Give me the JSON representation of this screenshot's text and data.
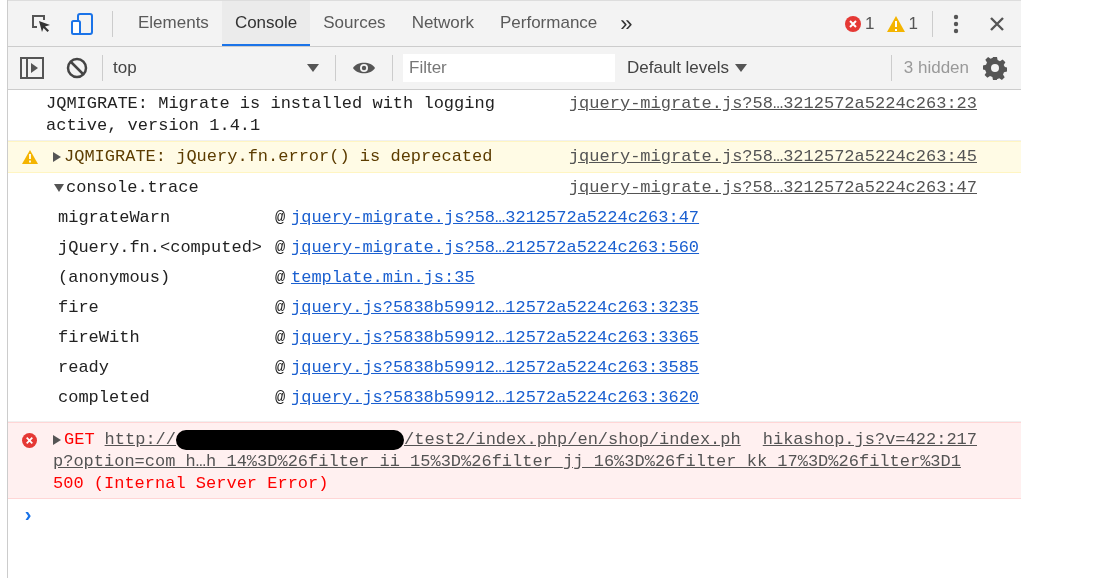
{
  "tabs": [
    {
      "label": "Elements",
      "selected": false
    },
    {
      "label": "Console",
      "selected": true
    },
    {
      "label": "Sources",
      "selected": false
    },
    {
      "label": "Network",
      "selected": false
    },
    {
      "label": "Performance",
      "selected": false
    }
  ],
  "more_tabs": "»",
  "counts": {
    "errors": "1",
    "warnings": "1"
  },
  "toolbar": {
    "context": "top",
    "filter_placeholder": "Filter",
    "levels": "Default levels",
    "hidden": "3 hidden"
  },
  "messages": [
    {
      "kind": "log",
      "text": "JQMIGRATE: Migrate is installed with logging active, version 1.4.1",
      "source": "jquery-migrate.js?58…3212572a5224c263:23"
    },
    {
      "kind": "warning",
      "expanded": false,
      "text": "JQMIGRATE: jQuery.fn.error() is deprecated",
      "source": "jquery-migrate.js?58…3212572a5224c263:45"
    },
    {
      "kind": "trace",
      "expanded": true,
      "text": "console.trace",
      "source": "jquery-migrate.js?58…3212572a5224c263:47",
      "frames": [
        {
          "function": "migrateWarn",
          "at": "@",
          "link": "jquery-migrate.js?58…3212572a5224c263:47"
        },
        {
          "function": "jQuery.fn.<computed>",
          "at": "@",
          "link": "jquery-migrate.js?58…212572a5224c263:560"
        },
        {
          "function": "(anonymous)",
          "at": "@",
          "link": "template.min.js:35"
        },
        {
          "function": "fire",
          "at": "@",
          "link": "jquery.js?5838b59912…12572a5224c263:3235"
        },
        {
          "function": "fireWith",
          "at": "@",
          "link": "jquery.js?5838b59912…12572a5224c263:3365"
        },
        {
          "function": "ready",
          "at": "@",
          "link": "jquery.js?5838b59912…12572a5224c263:3585"
        },
        {
          "function": "completed",
          "at": "@",
          "link": "jquery.js?5838b59912…12572a5224c263:3620"
        }
      ]
    },
    {
      "kind": "error",
      "expanded": false,
      "method": "GET",
      "url_start": "http://",
      "url_end": "/test2/index.php/en/shop/index.ph",
      "url_rest": "p?option=com_h…h_14%3D%26filter_ii_15%3D%26filter_jj_16%3D%26filter_kk_17%3D%26filter%3D1",
      "status": "500 (Internal Server Error)",
      "source": "hikashop.js?v=422:217"
    }
  ],
  "prompt": "›"
}
